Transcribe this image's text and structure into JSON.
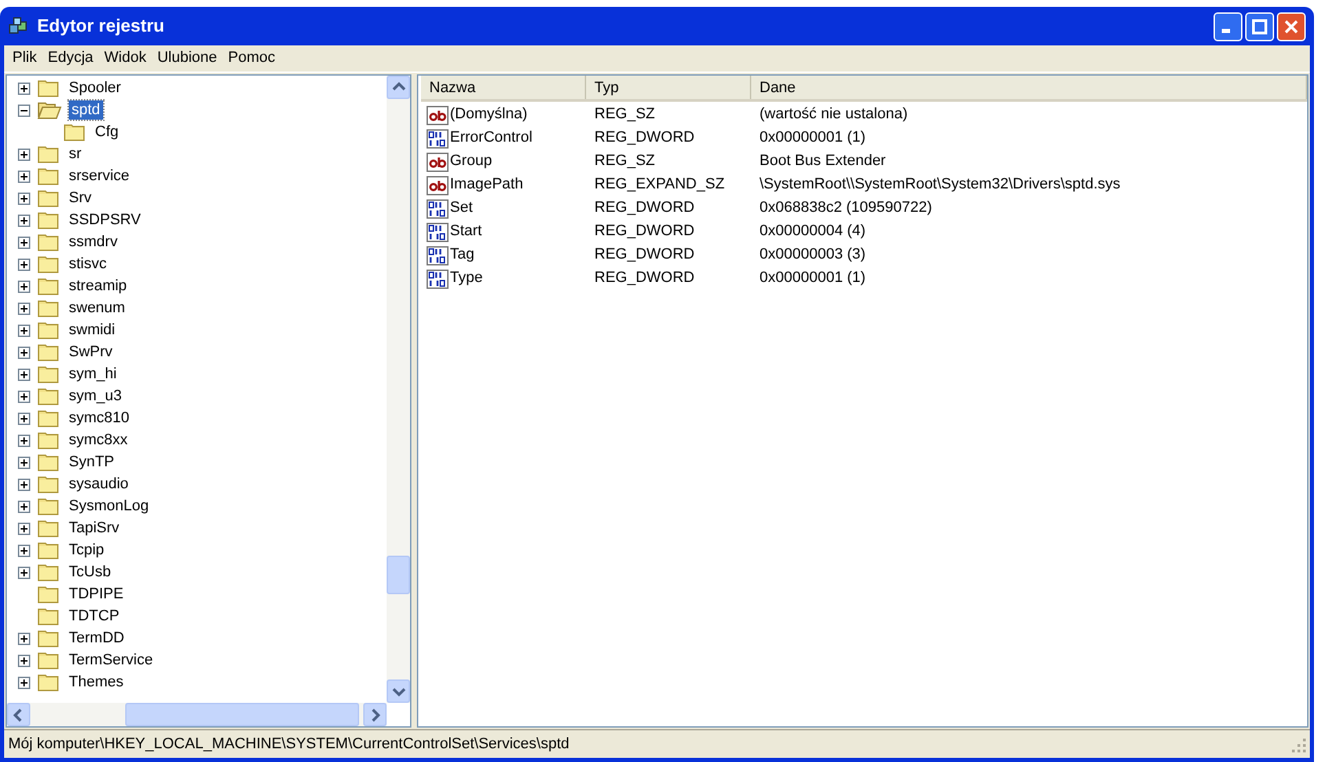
{
  "window": {
    "title": "Edytor rejestru"
  },
  "menu": [
    "Plik",
    "Edycja",
    "Widok",
    "Ulubione",
    "Pomoc"
  ],
  "tree": [
    {
      "label": "Spooler",
      "expandable": true,
      "expanded": false,
      "selected": false
    },
    {
      "label": "sptd",
      "expandable": true,
      "expanded": true,
      "selected": true,
      "children": [
        {
          "label": "Cfg",
          "expandable": false,
          "expanded": false,
          "selected": false
        }
      ]
    },
    {
      "label": "sr",
      "expandable": true,
      "expanded": false,
      "selected": false
    },
    {
      "label": "srservice",
      "expandable": true,
      "expanded": false,
      "selected": false
    },
    {
      "label": "Srv",
      "expandable": true,
      "expanded": false,
      "selected": false
    },
    {
      "label": "SSDPSRV",
      "expandable": true,
      "expanded": false,
      "selected": false
    },
    {
      "label": "ssmdrv",
      "expandable": true,
      "expanded": false,
      "selected": false
    },
    {
      "label": "stisvc",
      "expandable": true,
      "expanded": false,
      "selected": false
    },
    {
      "label": "streamip",
      "expandable": true,
      "expanded": false,
      "selected": false
    },
    {
      "label": "swenum",
      "expandable": true,
      "expanded": false,
      "selected": false
    },
    {
      "label": "swmidi",
      "expandable": true,
      "expanded": false,
      "selected": false
    },
    {
      "label": "SwPrv",
      "expandable": true,
      "expanded": false,
      "selected": false
    },
    {
      "label": "sym_hi",
      "expandable": true,
      "expanded": false,
      "selected": false
    },
    {
      "label": "sym_u3",
      "expandable": true,
      "expanded": false,
      "selected": false
    },
    {
      "label": "symc810",
      "expandable": true,
      "expanded": false,
      "selected": false
    },
    {
      "label": "symc8xx",
      "expandable": true,
      "expanded": false,
      "selected": false
    },
    {
      "label": "SynTP",
      "expandable": true,
      "expanded": false,
      "selected": false
    },
    {
      "label": "sysaudio",
      "expandable": true,
      "expanded": false,
      "selected": false
    },
    {
      "label": "SysmonLog",
      "expandable": true,
      "expanded": false,
      "selected": false
    },
    {
      "label": "TapiSrv",
      "expandable": true,
      "expanded": false,
      "selected": false
    },
    {
      "label": "Tcpip",
      "expandable": true,
      "expanded": false,
      "selected": false
    },
    {
      "label": "TcUsb",
      "expandable": true,
      "expanded": false,
      "selected": false
    },
    {
      "label": "TDPIPE",
      "expandable": false,
      "expanded": false,
      "selected": false
    },
    {
      "label": "TDTCP",
      "expandable": false,
      "expanded": false,
      "selected": false
    },
    {
      "label": "TermDD",
      "expandable": true,
      "expanded": false,
      "selected": false
    },
    {
      "label": "TermService",
      "expandable": true,
      "expanded": false,
      "selected": false
    },
    {
      "label": "Themes",
      "expandable": true,
      "expanded": false,
      "selected": false
    }
  ],
  "table": {
    "columns": [
      "Nazwa",
      "Typ",
      "Dane"
    ],
    "rows": [
      {
        "kind": "string",
        "name": "(Domyślna)",
        "type": "REG_SZ",
        "data": "(wartość nie ustalona)"
      },
      {
        "kind": "binary",
        "name": "ErrorControl",
        "type": "REG_DWORD",
        "data": "0x00000001 (1)"
      },
      {
        "kind": "string",
        "name": "Group",
        "type": "REG_SZ",
        "data": "Boot Bus Extender"
      },
      {
        "kind": "string",
        "name": "ImagePath",
        "type": "REG_EXPAND_SZ",
        "data": "\\SystemRoot\\\\SystemRoot\\System32\\Drivers\\sptd.sys"
      },
      {
        "kind": "binary",
        "name": "Set",
        "type": "REG_DWORD",
        "data": "0x068838c2 (109590722)"
      },
      {
        "kind": "binary",
        "name": "Start",
        "type": "REG_DWORD",
        "data": "0x00000004 (4)"
      },
      {
        "kind": "binary",
        "name": "Tag",
        "type": "REG_DWORD",
        "data": "0x00000003 (3)"
      },
      {
        "kind": "binary",
        "name": "Type",
        "type": "REG_DWORD",
        "data": "0x00000001 (1)"
      }
    ]
  },
  "status_bar": "Mój komputer\\HKEY_LOCAL_MACHINE\\SYSTEM\\CurrentControlSet\\Services\\sptd"
}
